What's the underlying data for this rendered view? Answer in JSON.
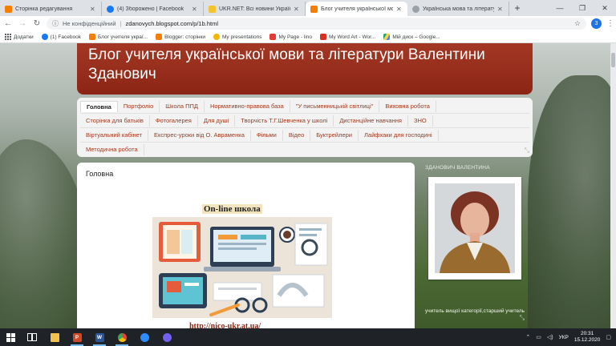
{
  "browser": {
    "tabs": [
      {
        "title": "Сторінка редагування",
        "favicon_color": "#f57d00",
        "active": false
      },
      {
        "title": "(4) Зборожено | Facebook",
        "favicon_color": "#1877f2",
        "active": false
      },
      {
        "title": "UKR.NET: Всі новини України",
        "favicon_color": "#f4c430",
        "active": false
      },
      {
        "title": "Блог учителя української мов",
        "favicon_color": "#f57d00",
        "active": true
      },
      {
        "title": "Українська мова та література",
        "favicon_color": "#9aa0a6",
        "active": false
      }
    ],
    "new_tab": "+",
    "address": {
      "security_label": "Не конфіденційний",
      "separator": "|",
      "url": "zdanovych.blogspot.com/p/1b.html"
    },
    "profile_initial": "3",
    "bookmarks": [
      {
        "label": "Додатки",
        "icon": "apps-icon"
      },
      {
        "label": "(1) Facebook",
        "icon": "facebook-icon",
        "color": "#1877f2"
      },
      {
        "label": "Блог учителя украї...",
        "icon": "blogger-icon",
        "color": "#f57d00"
      },
      {
        "label": "Blogger: сторінки",
        "icon": "blogger-icon",
        "color": "#f57d00"
      },
      {
        "label": "My presentations",
        "icon": "presentation-icon",
        "color": "#f4b400"
      },
      {
        "label": "My Page - lino",
        "icon": "lino-icon",
        "color": "#e53935"
      },
      {
        "label": "My Word Art - Wor...",
        "icon": "wordart-icon",
        "color": "#d93025"
      },
      {
        "label": "Мій диск – Google...",
        "icon": "drive-icon",
        "color": "#1fa463"
      }
    ]
  },
  "blog": {
    "title": "Блог учителя української мови та літератури Валентини Зданович",
    "nav_rows": [
      [
        "Головна",
        "Портфоліо",
        "Школа ППД",
        "Нормативно-правова база",
        "\"У письменницькій світлиці\"",
        "Виховна робота"
      ],
      [
        "Сторінка для батьків",
        "Фотогалерея",
        "Для душі",
        "Творчість Т.Г.Шевченка у школі",
        "Дистанційне навчання",
        "ЗНО"
      ],
      [
        "Віртуальний кабінет",
        "Експрес-уроки від О. Авраменка",
        "Фільми",
        "Відео",
        "Буктрейлери",
        "Лайфхаки для господині"
      ],
      [
        "Методична робота"
      ]
    ],
    "post": {
      "title": "Головна",
      "image_caption": "On-line школа",
      "link": "http://nico-ukr.at.ua/"
    },
    "sidebar": {
      "heading": "ЗДАНОВИЧ ВАЛЕНТИНА",
      "description": "учитель вищої категорії,старший учитель"
    }
  },
  "taskbar": {
    "apps": [
      {
        "name": "task-view",
        "running": false
      },
      {
        "name": "file-explorer",
        "running": false
      },
      {
        "name": "powerpoint",
        "running": true
      },
      {
        "name": "word",
        "running": true
      },
      {
        "name": "chrome",
        "running": true
      },
      {
        "name": "zoom",
        "running": false
      },
      {
        "name": "viber",
        "running": false
      }
    ],
    "language": "УКР",
    "time": "20:31",
    "date": "15.12.2020"
  }
}
